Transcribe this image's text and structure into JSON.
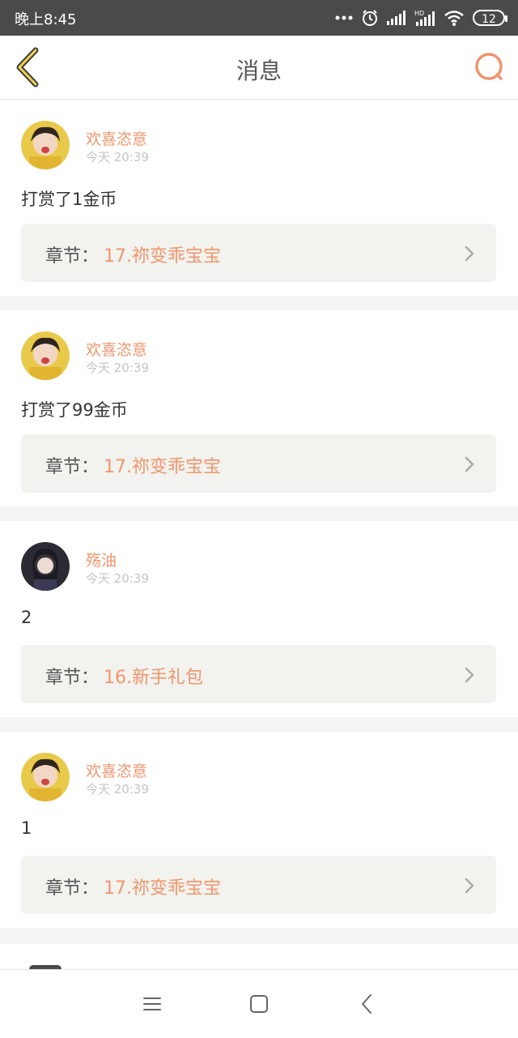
{
  "status_bar": {
    "time": "晚上8:45",
    "battery": "12",
    "icons": [
      "more-dots-icon",
      "alarm-icon",
      "signal-icon",
      "hd-signal-icon",
      "wifi-icon",
      "battery-icon"
    ]
  },
  "header": {
    "title": "消息",
    "back_icon": "chevron-left-icon",
    "search_icon": "search-icon"
  },
  "messages": [
    {
      "user": "欢喜恣意",
      "time": "今天 20:39",
      "text": "打赏了1金币",
      "chapter_label": "章节：",
      "chapter": "17.祢变乖宝宝"
    },
    {
      "user": "欢喜恣意",
      "time": "今天 20:39",
      "text": "打赏了99金币",
      "chapter_label": "章节：",
      "chapter": "17.祢变乖宝宝"
    },
    {
      "user": "殇油",
      "time": "今天 20:39",
      "text": "2",
      "chapter_label": "章节：",
      "chapter": "16.新手礼包"
    },
    {
      "user": "欢喜恣意",
      "time": "今天 20:39",
      "text": "1",
      "chapter_label": "章节：",
      "chapter": "17.祢变乖宝宝"
    }
  ],
  "colors": {
    "accent": "#f0956c",
    "status_bar": "#4a4a4a",
    "chapter_bg": "#f2f2ee",
    "page_bg": "#f4f4f4"
  },
  "nav": {
    "icons": [
      "menu-icon",
      "home-square-icon",
      "back-icon"
    ]
  }
}
